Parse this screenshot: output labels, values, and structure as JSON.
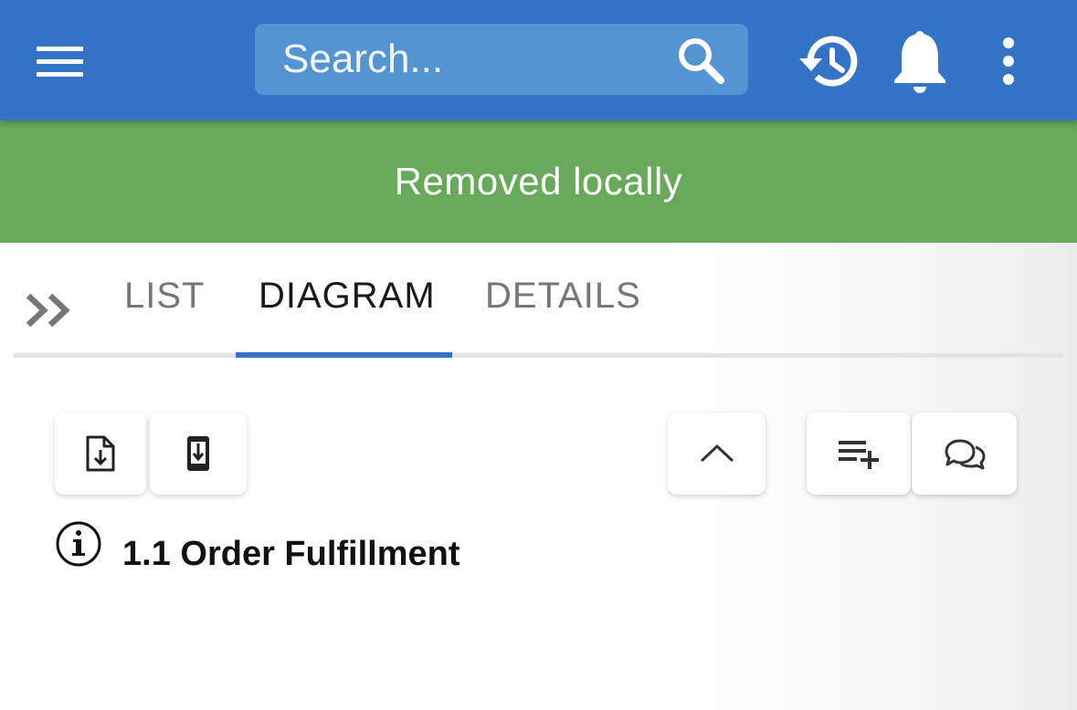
{
  "topbar": {
    "menu_icon": "hamburger-menu-icon",
    "search": {
      "placeholder": "Search...",
      "value": "",
      "icon": "search-icon"
    },
    "history_icon": "history-icon",
    "notifications_icon": "bell-icon",
    "more_icon": "more-vertical-icon",
    "background_color": "#3474c6",
    "search_background_color": "#5494d3"
  },
  "banner": {
    "message": "Removed locally",
    "background_color": "#66aa5a"
  },
  "tabs": {
    "expand_icon": "double-chevron-right-icon",
    "items": [
      {
        "label": "LIST",
        "active": false
      },
      {
        "label": "DIAGRAM",
        "active": true
      },
      {
        "label": "DETAILS",
        "active": false
      }
    ],
    "indicator_color": "#3474c6"
  },
  "toolbar": {
    "buttons": [
      {
        "name": "download-file",
        "icon": "file-download-icon"
      },
      {
        "name": "download-to-device",
        "icon": "mobile-download-icon"
      },
      {
        "name": "collapse",
        "icon": "chevron-up-icon"
      },
      {
        "name": "add-to-list",
        "icon": "playlist-add-icon"
      },
      {
        "name": "comments",
        "icon": "chat-bubbles-icon"
      }
    ]
  },
  "content": {
    "info_icon": "info-icon",
    "title": "1.1 Order Fulfillment"
  }
}
